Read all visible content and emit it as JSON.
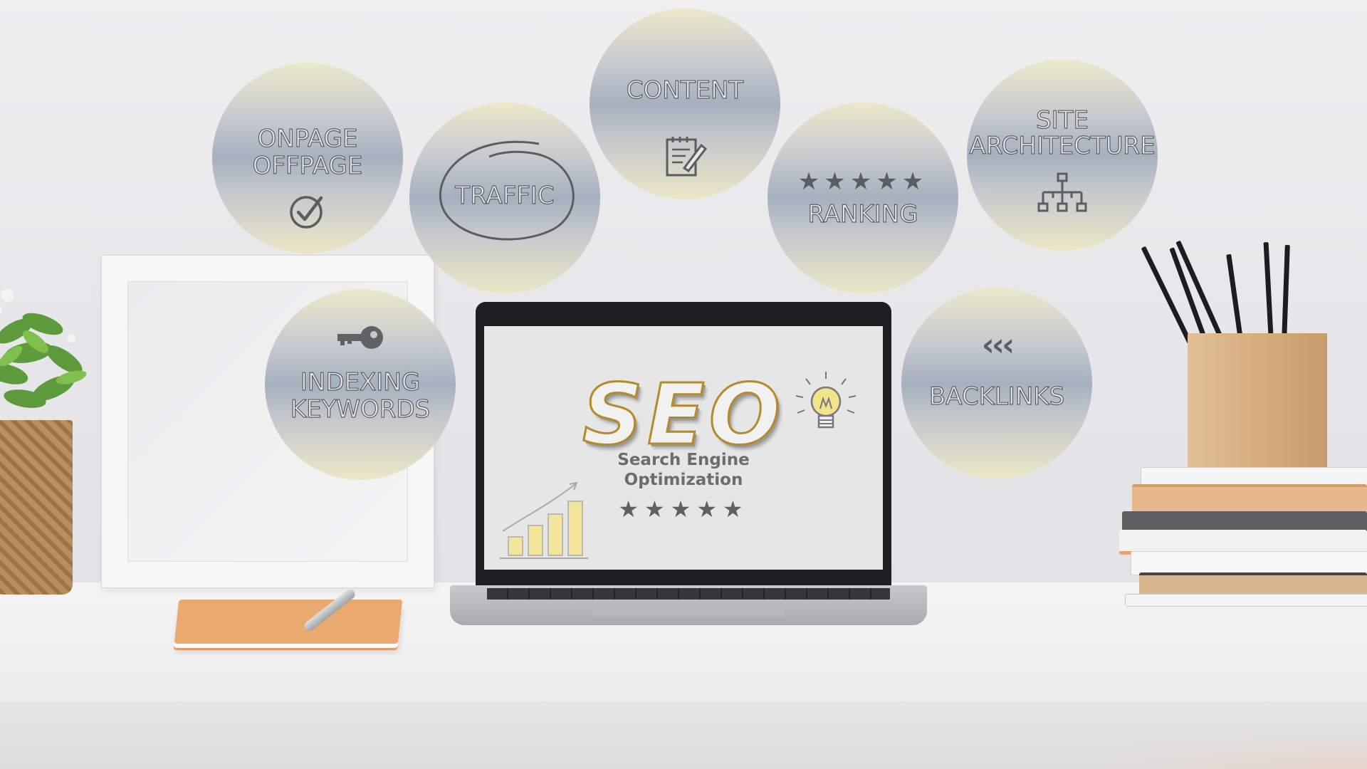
{
  "bubbles": {
    "onpage": {
      "line1": "ONPAGE",
      "line2": "OFFPAGE",
      "icon": "checkmark-icon"
    },
    "traffic": {
      "label": "TRAFFIC",
      "icon": "circle-scribble-icon"
    },
    "content": {
      "label": "CONTENT",
      "icon": "notepad-pencil-icon"
    },
    "ranking": {
      "stars": "★★★★★",
      "label": "RANKING"
    },
    "site": {
      "line1": "SITE",
      "line2": "ARCHITECTURE",
      "icon": "sitemap-icon"
    },
    "indexing": {
      "line1": "INDEXING",
      "line2": "KEYWORDS",
      "icon": "key-icon"
    },
    "backlinks": {
      "arrows": "‹‹‹",
      "label": "BACKLINKS"
    }
  },
  "laptop": {
    "logo": "SEO",
    "sub_line1": "Search Engine",
    "sub_line2": "Optimization",
    "stars": "★★★★★",
    "icons": [
      "lightbulb-icon",
      "growth-chart-icon"
    ]
  },
  "colors": {
    "bubble_top": "#ede8c8",
    "bubble_mid": "#a3aebd",
    "seo_outline": "#b48a2a",
    "notebook": "#e9a96f"
  }
}
